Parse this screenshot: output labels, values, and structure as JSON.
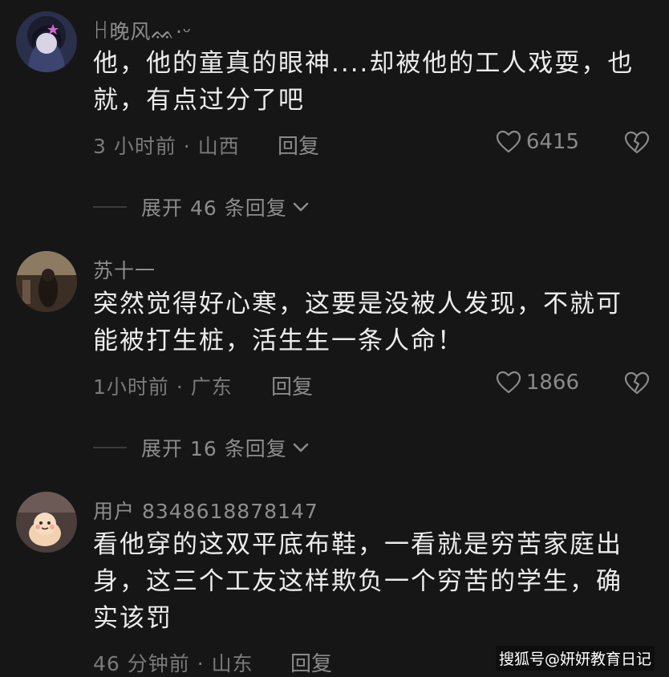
{
  "comments": [
    {
      "username": "ꀿ晚风ᨐ·ᵕ",
      "text": "他，他的童真的眼神....却被他的工人戏耍，也就，有点过分了吧",
      "meta": "3 小时前 · 山西",
      "reply_label": "回复",
      "likes": "6415",
      "expand_label": "展开 46 条回复"
    },
    {
      "username": "苏十一",
      "text": "突然觉得好心寒，这要是没被人发现，不就可能被打生桩，活生生一条人命！",
      "meta": "1小时前 · 广东",
      "reply_label": "回复",
      "likes": "1866",
      "expand_label": "展开 16 条回复"
    },
    {
      "username": "用户 8348618878147",
      "text": "看他穿的这双平底布鞋，一看就是穷苦家庭出身，这三个工友这样欺负一个穷苦的学生，确实该罚",
      "meta": "46 分钟前 · 山东",
      "reply_label": "回复"
    }
  ],
  "watermark": "搜狐号@妍妍教育日记",
  "icons": {
    "like": "heart-icon",
    "dislike": "broken-heart-icon",
    "expand": "chevron-down-icon"
  },
  "colors": {
    "background": "#161616",
    "text": "#ececec",
    "muted": "#8a8a8a"
  }
}
